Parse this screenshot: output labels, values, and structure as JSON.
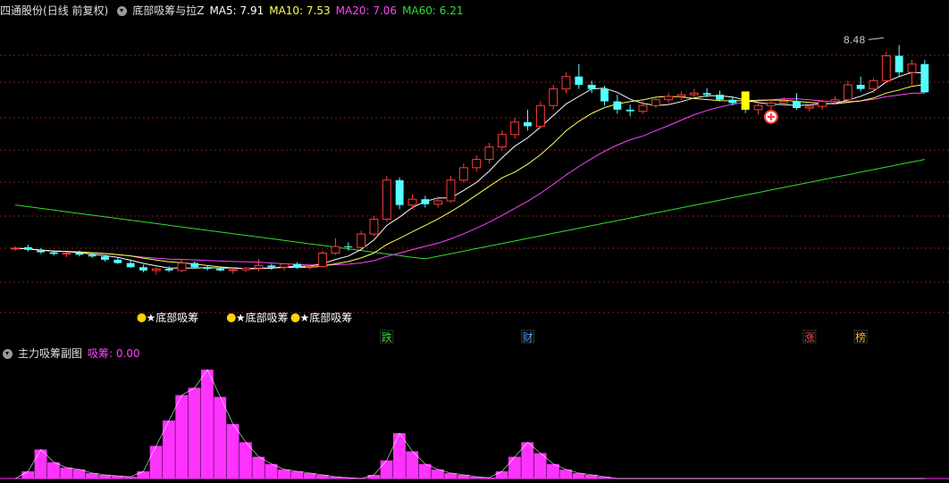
{
  "main_header": {
    "stock_title": "四通股份",
    "period_mode": "(日线 前复权)",
    "indicator_name": "底部吸筹与拉Z",
    "ma5": "MA5: 7.91",
    "ma10": "MA10: 7.53",
    "ma20": "MA20: 7.06",
    "ma60": "MA60: 6.21"
  },
  "sub_header": {
    "indicator_name": "主力吸筹副图",
    "value_label": "吸筹: 0.00"
  },
  "colors": {
    "up": "#ff3b3b",
    "down": "#54ffff",
    "ma5": "#ffffff",
    "ma10": "#ffff54",
    "ma20": "#ff44ff",
    "ma60": "#33dd33",
    "grid": "#8a1b1b",
    "bar": "#ff33ff",
    "signal": "#ffff00"
  },
  "price_scale": {
    "min": 5.2,
    "max": 8.7
  },
  "max_price_label": "8.48",
  "signal_labels": [
    {
      "bar": 10,
      "text": "★底部吸筹"
    },
    {
      "bar": 17,
      "text": "★底部吸筹"
    },
    {
      "bar": 22,
      "text": "★底部吸筹"
    }
  ],
  "event_tags": [
    {
      "bar": 29,
      "text": "跌",
      "color": "#33dd33"
    },
    {
      "bar": 40,
      "text": "财",
      "color": "#4fa3ff"
    },
    {
      "bar": 62,
      "text": "涨",
      "color": "#ff4444"
    },
    {
      "bar": 66,
      "text": "榜",
      "color": "#ffaa33"
    }
  ],
  "chart_data": {
    "type": "candlestick",
    "candles": [
      [
        6.02,
        6.05,
        6.0,
        6.03
      ],
      [
        6.04,
        6.07,
        5.99,
        6.01
      ],
      [
        6.0,
        6.03,
        5.96,
        5.98
      ],
      [
        5.98,
        6.0,
        5.94,
        5.96
      ],
      [
        5.96,
        5.99,
        5.92,
        5.97
      ],
      [
        5.97,
        6.0,
        5.93,
        5.95
      ],
      [
        5.95,
        5.98,
        5.91,
        5.93
      ],
      [
        5.93,
        5.95,
        5.87,
        5.89
      ],
      [
        5.89,
        5.92,
        5.84,
        5.85
      ],
      [
        5.85,
        5.88,
        5.79,
        5.8
      ],
      [
        5.8,
        5.83,
        5.74,
        5.76
      ],
      [
        5.76,
        5.8,
        5.71,
        5.78
      ],
      [
        5.78,
        5.81,
        5.74,
        5.76
      ],
      [
        5.76,
        5.9,
        5.74,
        5.85
      ],
      [
        5.85,
        5.87,
        5.78,
        5.8
      ],
      [
        5.8,
        5.82,
        5.76,
        5.78
      ],
      [
        5.78,
        5.8,
        5.75,
        5.76
      ],
      [
        5.76,
        5.79,
        5.72,
        5.77
      ],
      [
        5.77,
        5.8,
        5.74,
        5.79
      ],
      [
        5.79,
        5.9,
        5.75,
        5.82
      ],
      [
        5.82,
        5.84,
        5.77,
        5.8
      ],
      [
        5.8,
        5.85,
        5.76,
        5.84
      ],
      [
        5.84,
        5.86,
        5.78,
        5.8
      ],
      [
        5.8,
        5.84,
        5.77,
        5.81
      ],
      [
        5.81,
        6.0,
        5.79,
        5.97
      ],
      [
        5.97,
        6.15,
        5.95,
        6.05
      ],
      [
        6.05,
        6.1,
        6.0,
        6.04
      ],
      [
        6.04,
        6.24,
        6.02,
        6.2
      ],
      [
        6.2,
        6.42,
        6.18,
        6.38
      ],
      [
        6.38,
        6.9,
        6.35,
        6.85
      ],
      [
        6.85,
        6.88,
        6.5,
        6.55
      ],
      [
        6.55,
        6.68,
        6.5,
        6.62
      ],
      [
        6.62,
        6.66,
        6.52,
        6.56
      ],
      [
        6.56,
        6.65,
        6.52,
        6.6
      ],
      [
        6.6,
        6.9,
        6.58,
        6.85
      ],
      [
        6.85,
        7.05,
        6.82,
        7.0
      ],
      [
        7.0,
        7.15,
        6.95,
        7.1
      ],
      [
        7.1,
        7.3,
        7.05,
        7.25
      ],
      [
        7.25,
        7.45,
        7.2,
        7.4
      ],
      [
        7.4,
        7.6,
        7.35,
        7.55
      ],
      [
        7.55,
        7.7,
        7.45,
        7.5
      ],
      [
        7.5,
        7.8,
        7.48,
        7.75
      ],
      [
        7.75,
        8.0,
        7.7,
        7.95
      ],
      [
        7.95,
        8.15,
        7.9,
        8.1
      ],
      [
        8.1,
        8.25,
        7.95,
        8.0
      ],
      [
        8.0,
        8.05,
        7.9,
        7.95
      ],
      [
        7.95,
        7.99,
        7.75,
        7.8
      ],
      [
        7.8,
        7.88,
        7.65,
        7.7
      ],
      [
        7.7,
        7.76,
        7.62,
        7.68
      ],
      [
        7.68,
        7.8,
        7.65,
        7.75
      ],
      [
        7.75,
        7.85,
        7.72,
        7.82
      ],
      [
        7.82,
        7.9,
        7.78,
        7.86
      ],
      [
        7.86,
        7.92,
        7.82,
        7.88
      ],
      [
        7.88,
        7.95,
        7.84,
        7.9
      ],
      [
        7.9,
        7.96,
        7.85,
        7.88
      ],
      [
        7.88,
        7.93,
        7.8,
        7.82
      ],
      [
        7.82,
        7.86,
        7.75,
        7.78
      ],
      [
        7.78,
        7.82,
        7.66,
        7.7
      ],
      [
        7.7,
        7.78,
        7.64,
        7.75
      ],
      [
        7.75,
        7.82,
        7.7,
        7.78
      ],
      [
        7.78,
        7.85,
        7.74,
        7.8
      ],
      [
        7.8,
        7.9,
        7.7,
        7.72
      ],
      [
        7.72,
        7.76,
        7.68,
        7.74
      ],
      [
        7.74,
        7.82,
        7.7,
        7.8
      ],
      [
        7.8,
        7.86,
        7.76,
        7.82
      ],
      [
        7.82,
        8.05,
        7.8,
        8.0
      ],
      [
        8.0,
        8.1,
        7.92,
        7.95
      ],
      [
        7.95,
        8.08,
        7.9,
        8.05
      ],
      [
        8.05,
        8.4,
        8.02,
        8.35
      ],
      [
        8.35,
        8.48,
        8.1,
        8.15
      ],
      [
        8.15,
        8.3,
        8.0,
        8.25
      ],
      [
        8.25,
        8.3,
        7.9,
        7.91
      ]
    ],
    "ma_series": [
      "MA5",
      "MA10",
      "MA20",
      "MA60"
    ],
    "sub_series": {
      "name": "吸筹",
      "values": [
        0,
        0.4,
        1.6,
        0.9,
        0.6,
        0.5,
        0.3,
        0.2,
        0.15,
        0.1,
        0.4,
        1.8,
        3.2,
        4.6,
        5.0,
        6.0,
        4.5,
        3.0,
        2.0,
        1.2,
        0.8,
        0.5,
        0.4,
        0.3,
        0.2,
        0.1,
        0.05,
        0,
        0.2,
        1.0,
        2.5,
        1.5,
        0.8,
        0.5,
        0.3,
        0.2,
        0.1,
        0.05,
        0.4,
        1.2,
        2.0,
        1.4,
        0.8,
        0.5,
        0.3,
        0.2,
        0.1,
        0,
        0,
        0,
        0,
        0,
        0,
        0,
        0,
        0,
        0,
        0,
        0,
        0,
        0,
        0,
        0,
        0,
        0,
        0,
        0,
        0,
        0,
        0,
        0,
        0
      ]
    }
  }
}
